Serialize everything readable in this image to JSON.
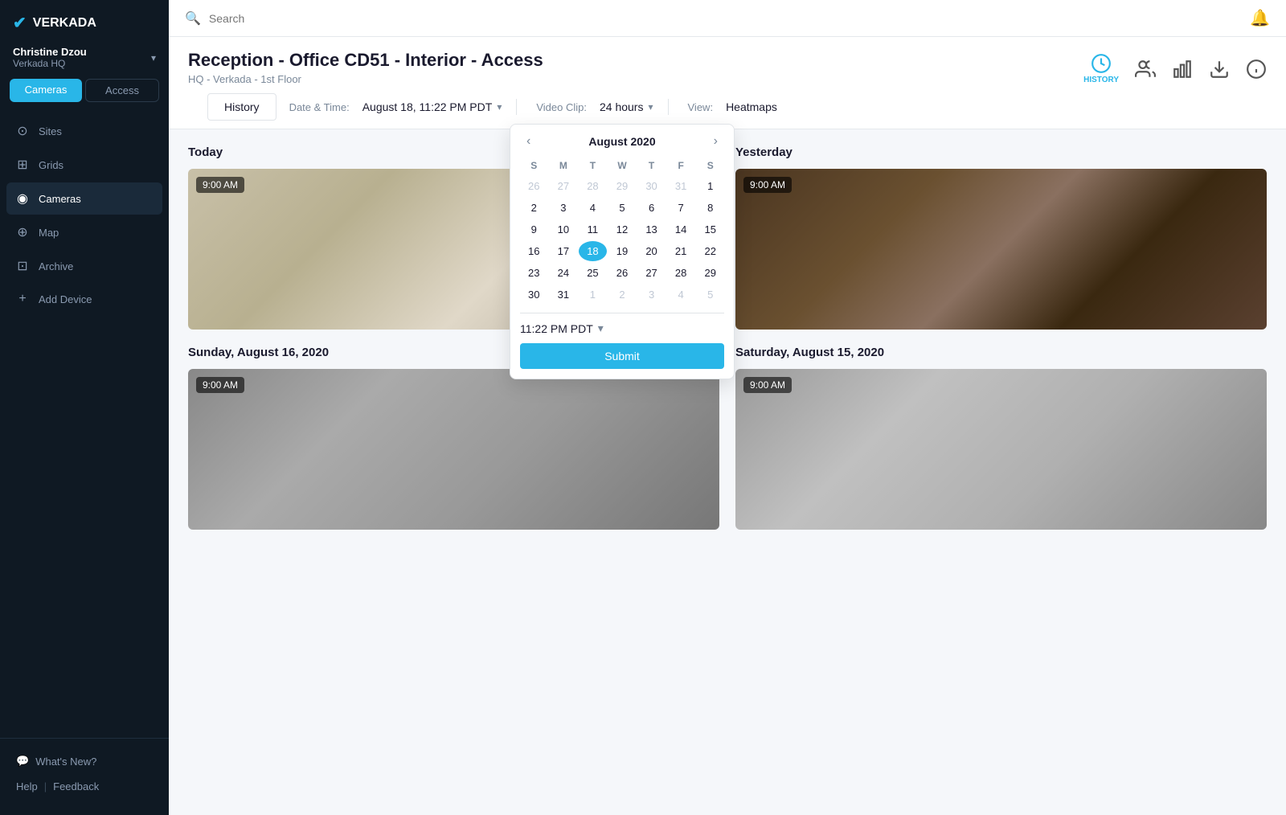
{
  "app": {
    "logo": "VERKADA",
    "checkmark": "✔"
  },
  "sidebar": {
    "user": {
      "name": "Christine Dzou",
      "org": "Verkada HQ",
      "chevron": "▾"
    },
    "tabs": [
      {
        "id": "cameras",
        "label": "Cameras",
        "active": true
      },
      {
        "id": "access",
        "label": "Access",
        "active": false
      }
    ],
    "nav_items": [
      {
        "id": "sites",
        "label": "Sites",
        "icon": "⊙",
        "active": false
      },
      {
        "id": "grids",
        "label": "Grids",
        "icon": "⊞",
        "active": false
      },
      {
        "id": "cameras",
        "label": "Cameras",
        "icon": "◉",
        "active": true
      },
      {
        "id": "map",
        "label": "Map",
        "icon": "⊕",
        "active": false
      },
      {
        "id": "archive",
        "label": "Archive",
        "icon": "⊡",
        "active": false
      },
      {
        "id": "add-device",
        "label": "Add Device",
        "icon": "+",
        "active": false
      }
    ],
    "bottom": {
      "whats_new": "What's New?",
      "help": "Help",
      "feedback": "Feedback",
      "separator": "|"
    }
  },
  "topbar": {
    "search_placeholder": "Search",
    "bell_icon": "🔔"
  },
  "header": {
    "title": "Reception - Office CD51 - Interior - Access",
    "subtitle": "HQ - Verkada - 1st Floor",
    "icons": [
      {
        "id": "history",
        "label": "HISTORY",
        "active": true
      },
      {
        "id": "people",
        "label": "",
        "active": false
      },
      {
        "id": "chart",
        "label": "",
        "active": false
      },
      {
        "id": "export",
        "label": "",
        "active": false
      },
      {
        "id": "info",
        "label": "",
        "active": false
      }
    ]
  },
  "toolbar": {
    "history_btn": "History",
    "date_label": "Date & Time:",
    "date_value": "August 18, 11:22 PM PDT",
    "date_caret": "▾",
    "video_label": "Video Clip:",
    "video_value": "24 hours",
    "video_caret": "▾",
    "view_label": "View:",
    "view_value": "Heatmaps"
  },
  "calendar": {
    "month_year": "August 2020",
    "prev": "‹",
    "next": "›",
    "days_of_week": [
      "S",
      "M",
      "T",
      "W",
      "T",
      "F",
      "S"
    ],
    "weeks": [
      [
        {
          "day": 26,
          "other": true
        },
        {
          "day": 27,
          "other": true
        },
        {
          "day": 28,
          "other": true
        },
        {
          "day": 29,
          "other": true
        },
        {
          "day": 30,
          "other": true
        },
        {
          "day": 31,
          "other": true
        },
        {
          "day": 1,
          "other": false
        }
      ],
      [
        {
          "day": 2,
          "other": false
        },
        {
          "day": 3,
          "other": false
        },
        {
          "day": 4,
          "other": false
        },
        {
          "day": 5,
          "other": false
        },
        {
          "day": 6,
          "other": false
        },
        {
          "day": 7,
          "other": false
        },
        {
          "day": 8,
          "other": false
        }
      ],
      [
        {
          "day": 9,
          "other": false
        },
        {
          "day": 10,
          "other": false
        },
        {
          "day": 11,
          "other": false
        },
        {
          "day": 12,
          "other": false
        },
        {
          "day": 13,
          "other": false
        },
        {
          "day": 14,
          "other": false
        },
        {
          "day": 15,
          "other": false
        }
      ],
      [
        {
          "day": 16,
          "other": false
        },
        {
          "day": 17,
          "other": false
        },
        {
          "day": 18,
          "other": false,
          "selected": true
        },
        {
          "day": 19,
          "other": false
        },
        {
          "day": 20,
          "other": false
        },
        {
          "day": 21,
          "other": false
        },
        {
          "day": 22,
          "other": false
        }
      ],
      [
        {
          "day": 23,
          "other": false
        },
        {
          "day": 24,
          "other": false
        },
        {
          "day": 25,
          "other": false
        },
        {
          "day": 26,
          "other": false
        },
        {
          "day": 27,
          "other": false
        },
        {
          "day": 28,
          "other": false
        },
        {
          "day": 29,
          "other": false
        }
      ],
      [
        {
          "day": 30,
          "other": false
        },
        {
          "day": 31,
          "other": false
        },
        {
          "day": 1,
          "other": true
        },
        {
          "day": 2,
          "other": true
        },
        {
          "day": 3,
          "other": true
        },
        {
          "day": 4,
          "other": true
        },
        {
          "day": 5,
          "other": true
        }
      ]
    ],
    "time_value": "11:22 PM PDT",
    "time_caret": "▾",
    "submit_label": "Submit"
  },
  "content": {
    "sections": [
      {
        "id": "today",
        "label": "Today",
        "timestamp": "9:00 AM",
        "room_class": "room-today"
      },
      {
        "id": "yesterday",
        "label": "Yesterday",
        "timestamp": "9:00 AM",
        "room_class": "room-yesterday"
      },
      {
        "id": "sunday",
        "label": "Sunday, August 16, 2020",
        "timestamp": "9:00 AM",
        "room_class": "room-sunday"
      },
      {
        "id": "saturday",
        "label": "Saturday, August 15, 2020",
        "timestamp": "9:00 AM",
        "room_class": "room-saturday"
      }
    ]
  }
}
